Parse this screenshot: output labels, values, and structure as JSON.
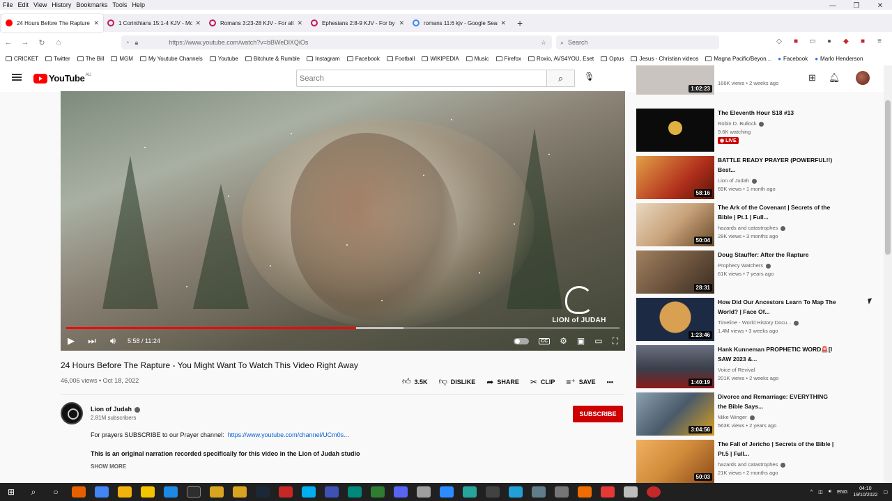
{
  "menu": [
    "File",
    "Edit",
    "View",
    "History",
    "Bookmarks",
    "Tools",
    "Help"
  ],
  "window_controls": [
    "—",
    "❐",
    "✕"
  ],
  "tabs": [
    {
      "title": "24 Hours Before The Rapture - Yo",
      "color": "#ff0000",
      "active": true
    },
    {
      "title": "1 Corinthians 15:1-4 KJV - Moreo",
      "color": "#c2185b",
      "active": false
    },
    {
      "title": "Romans 3:23-28 KJV - For all ha",
      "color": "#c2185b",
      "active": false
    },
    {
      "title": "Ephesians 2:8-9 KJV - For by gra",
      "color": "#c2185b",
      "active": false
    },
    {
      "title": "romans 11:6 kjv - Google Search",
      "color": "#4285f4",
      "active": false
    }
  ],
  "new_tab": "+",
  "nav": {
    "url": "https://www.youtube.com/watch?v=bBWeDlXQiOs",
    "search_placeholder": "Search"
  },
  "bookmarks": [
    "CRICKET",
    "Twitter",
    "The Bill",
    "MGM",
    "My Youtube Channels",
    "Youtube",
    "Bitchute & Rumble",
    "Instagram",
    "Facebook",
    "Football",
    "WIKIPEDIA",
    "Music",
    "Firefox",
    "Roxio, AVS4YOU, Eset",
    "Optus",
    "Jesus - Christian videos",
    "Magna Pacific/Beyon...",
    "Facebook",
    "Marlo Henderson"
  ],
  "youtube": {
    "logo": "YouTube",
    "country": "AU",
    "search_placeholder": "Search"
  },
  "player": {
    "time": "5:58 / 11:24",
    "played_fraction": 0.524,
    "buffered_fraction": 0.61,
    "watermark": "LION of JUDAH"
  },
  "video": {
    "title": "24 Hours Before The Rapture - You Might Want To Watch This Video Right Away",
    "meta": "46,006 views • Oct 18, 2022",
    "likes": "3.5K",
    "dislike": "DISLIKE",
    "share": "SHARE",
    "clip": "CLIP",
    "save": "SAVE",
    "more": "•••"
  },
  "channel": {
    "name": "Lion of Judah",
    "subs": "2.81M subscribers",
    "subscribe": "SUBSCRIBE",
    "desc_line1": "For prayers SUBSCRIBE to our Prayer channel:",
    "desc_link": "https://www.youtube.com/channel/UCm0s...",
    "desc_line2": "This is an original narration recorded specifically for this video in the Lion of Judah studio",
    "show_more": "SHOW MORE"
  },
  "recommendations": [
    {
      "title": "",
      "channel": "",
      "views": "166K views • 2 weeks ago",
      "duration": "1:02:23",
      "thumb": "#c9c4c0"
    },
    {
      "title": "The Eleventh Hour S18 #13",
      "channel": "Robin D. Bullock",
      "views": "9.6K watching",
      "duration": "",
      "live": "LIVE",
      "thumb": "#0b0b0b"
    },
    {
      "title": "BATTLE READY PRAYER (POWERFUL!!) Best...",
      "channel": "Lion of Judah",
      "views": "69K views • 1 month ago",
      "duration": "58:16",
      "thumb": "#b3311c"
    },
    {
      "title": "The Ark of the Covenant | Secrets of the Bible | Pt.1 | Full...",
      "channel": "hazards and catastrophes",
      "views": "28K views • 3 months ago",
      "duration": "50:04",
      "thumb": "#c8a27a"
    },
    {
      "title": "Doug Stauffer: After the Rapture",
      "channel": "Prophecy Watchers",
      "views": "61K views • 7 years ago",
      "duration": "28:31",
      "thumb": "#6f5640"
    },
    {
      "title": "How Did Our Ancestors Learn To Map The World? | Face Of...",
      "channel": "Timeline - World History Docu...",
      "views": "1.4M views • 3 weeks ago",
      "duration": "1:23:46",
      "thumb": "#1c2a44"
    },
    {
      "title": "Hank Kunneman PROPHETIC WORD🚨[I SAW 2023 &...",
      "channel": "Voice of Revival",
      "views": "201K views • 2 weeks ago",
      "duration": "1:40:19",
      "thumb": "#3a3f4a"
    },
    {
      "title": "Divorce and Remarriage: EVERYTHING the Bible Says...",
      "channel": "Mike Winger",
      "views": "563K views • 2 years ago",
      "duration": "3:04:56",
      "thumb": "#4a5a6a"
    },
    {
      "title": "The Fall of Jericho | Secrets of the Bible | Pt.5 | Full...",
      "channel": "hazards and catastrophes",
      "views": "21K views • 2 months ago",
      "duration": "50:03",
      "thumb": "#d08a3a"
    }
  ],
  "taskbar": {
    "lang": "ENG",
    "time": "04:10",
    "date": "19/10/2022"
  },
  "colors": {
    "accent_red": "#ff0000",
    "subscribe": "#cc0000",
    "link": "#065fd4"
  }
}
